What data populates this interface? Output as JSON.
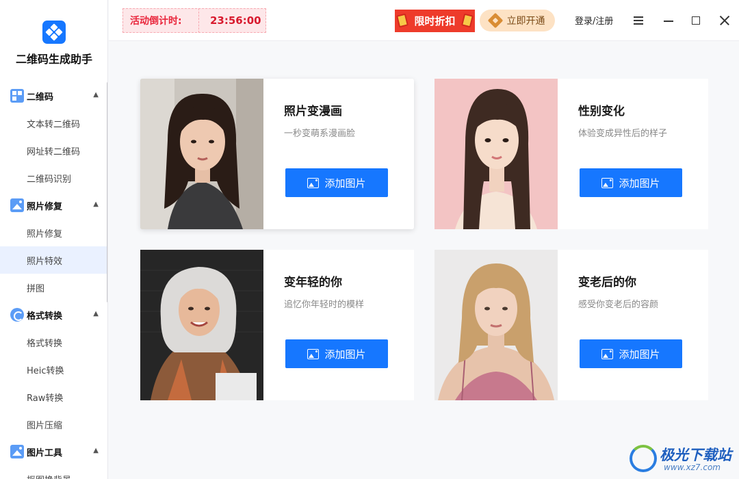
{
  "app": {
    "title": "二维码生成助手"
  },
  "sidebar": {
    "groups": [
      {
        "label": "二维码",
        "items": [
          "文本转二维码",
          "网址转二维码",
          "二维码识别"
        ]
      },
      {
        "label": "照片修复",
        "items": [
          "照片修复",
          "照片特效",
          "拼图"
        ]
      },
      {
        "label": "格式转换",
        "items": [
          "格式转换",
          "Heic转换",
          "Raw转换",
          "图片压缩"
        ]
      },
      {
        "label": "图片工具",
        "items": [
          "抠图换背景"
        ]
      }
    ],
    "active_item": "照片特效"
  },
  "topbar": {
    "countdown_label": "活动倒计时:",
    "countdown_time": "23:56:00",
    "discount_label": "限时折扣",
    "vip_label": "立即开通",
    "login_label": "登录/注册"
  },
  "cards": [
    {
      "title": "照片变漫画",
      "desc": "一秒变萌系漫画脸",
      "button": "添加图片"
    },
    {
      "title": "性别变化",
      "desc": "体验变成异性后的样子",
      "button": "添加图片"
    },
    {
      "title": "变年轻的你",
      "desc": "追忆你年轻时的模样",
      "button": "添加图片"
    },
    {
      "title": "变老后的你",
      "desc": "感受你变老后的容颜",
      "button": "添加图片"
    }
  ],
  "watermark": {
    "name": "极光下载站",
    "url": "www.xz7.com"
  },
  "colors": {
    "accent": "#1677ff",
    "countdown": "#e9263c",
    "discount": "#ee3b2b",
    "vip_bg": "#fde2c4",
    "active_item_bg": "#eaf1ff"
  }
}
